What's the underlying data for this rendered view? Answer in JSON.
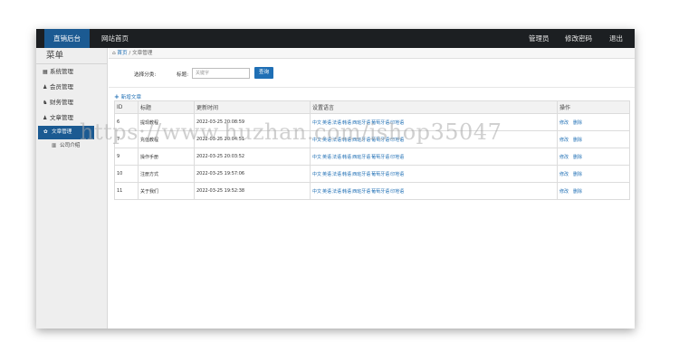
{
  "topbar": {
    "brand": "直销后台",
    "site_home": "网站首页",
    "admin": "管理员",
    "change_password": "修改密码",
    "logout": "退出"
  },
  "sidebar": {
    "title": "菜单",
    "items": [
      {
        "label": "系统管理",
        "icon": "settings-icon"
      },
      {
        "label": "会员管理",
        "icon": "user-icon"
      },
      {
        "label": "财务管理",
        "icon": "finance-icon"
      },
      {
        "label": "文章管理",
        "icon": "user-icon"
      }
    ],
    "subitems": [
      {
        "label": "文章管理",
        "icon": "gear-icon",
        "active": true
      },
      {
        "label": "公司介绍",
        "icon": "building-icon",
        "active": false
      }
    ]
  },
  "breadcrumb": {
    "home": "首页",
    "separator": "/",
    "current": "文章管理"
  },
  "filters": {
    "category_label": "选择分类:",
    "title_label": "标题:",
    "keyword_placeholder": "关键字",
    "query_button": "查询"
  },
  "add_button": "新增文章",
  "table": {
    "headers": [
      "ID",
      "标题",
      "更新时间",
      "设置语言",
      "操作"
    ],
    "rows": [
      {
        "id": "6",
        "title": "提现教程",
        "time": "2022-03-25 20:08:59"
      },
      {
        "id": "7",
        "title": "充值教程",
        "time": "2022-03-25 20:04:51"
      },
      {
        "id": "9",
        "title": "操作手册",
        "time": "2022-03-25 20:03:52"
      },
      {
        "id": "10",
        "title": "注册方式",
        "time": "2022-03-25 19:57:06"
      },
      {
        "id": "11",
        "title": "关于我们",
        "time": "2022-03-25 19:52:38"
      }
    ],
    "languages": [
      "中文",
      "英语",
      "法语",
      "韩语",
      "西班牙语",
      "葡萄牙语",
      "印地语"
    ],
    "actions": [
      "修改",
      "删除"
    ]
  },
  "watermark": "https://www.huzhan.com/ishop35047",
  "colors": {
    "topbar_bg": "#1c1f22",
    "brand_bg": "#1b5a92",
    "link": "#1f6fb5",
    "sidebar_bg": "#eeeeee"
  }
}
